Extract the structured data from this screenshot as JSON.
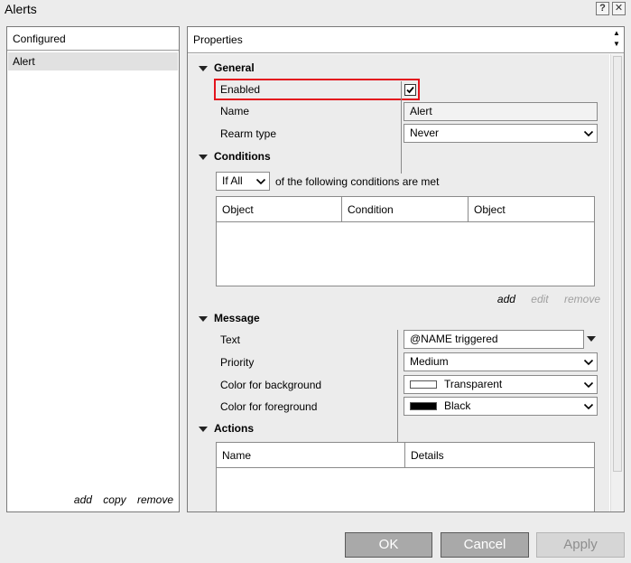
{
  "window": {
    "title": "Alerts",
    "help_label": "?",
    "close_label": "✕"
  },
  "configured": {
    "header": "Configured",
    "items": [
      "Alert"
    ],
    "actions": {
      "add": "add",
      "copy": "copy",
      "remove": "remove"
    }
  },
  "properties": {
    "header": "Properties",
    "general": {
      "label": "General",
      "enabled_label": "Enabled",
      "enabled_checked": true,
      "name_label": "Name",
      "name_value": "Alert",
      "rearm_label": "Rearm type",
      "rearm_value": "Never"
    },
    "conditions": {
      "label": "Conditions",
      "mode_value": "If All",
      "suffix": "of the following conditions are met",
      "columns": [
        "Object",
        "Condition",
        "Object"
      ],
      "actions": {
        "add": "add",
        "edit": "edit",
        "remove": "remove"
      }
    },
    "message": {
      "label": "Message",
      "text_label": "Text",
      "text_value": "@NAME triggered",
      "priority_label": "Priority",
      "priority_value": "Medium",
      "bg_label": "Color for background",
      "bg_value": "Transparent",
      "bg_swatch": "#ffffff",
      "fg_label": "Color for foreground",
      "fg_value": "Black",
      "fg_swatch": "#000000"
    },
    "actions": {
      "label": "Actions",
      "columns": [
        "Name",
        "Details"
      ]
    }
  },
  "buttons": {
    "ok": "OK",
    "cancel": "Cancel",
    "apply": "Apply"
  },
  "colors": {
    "highlight": "#e3141d",
    "button": "#a9a9a9",
    "button_disabled": "#d6d6d6"
  }
}
